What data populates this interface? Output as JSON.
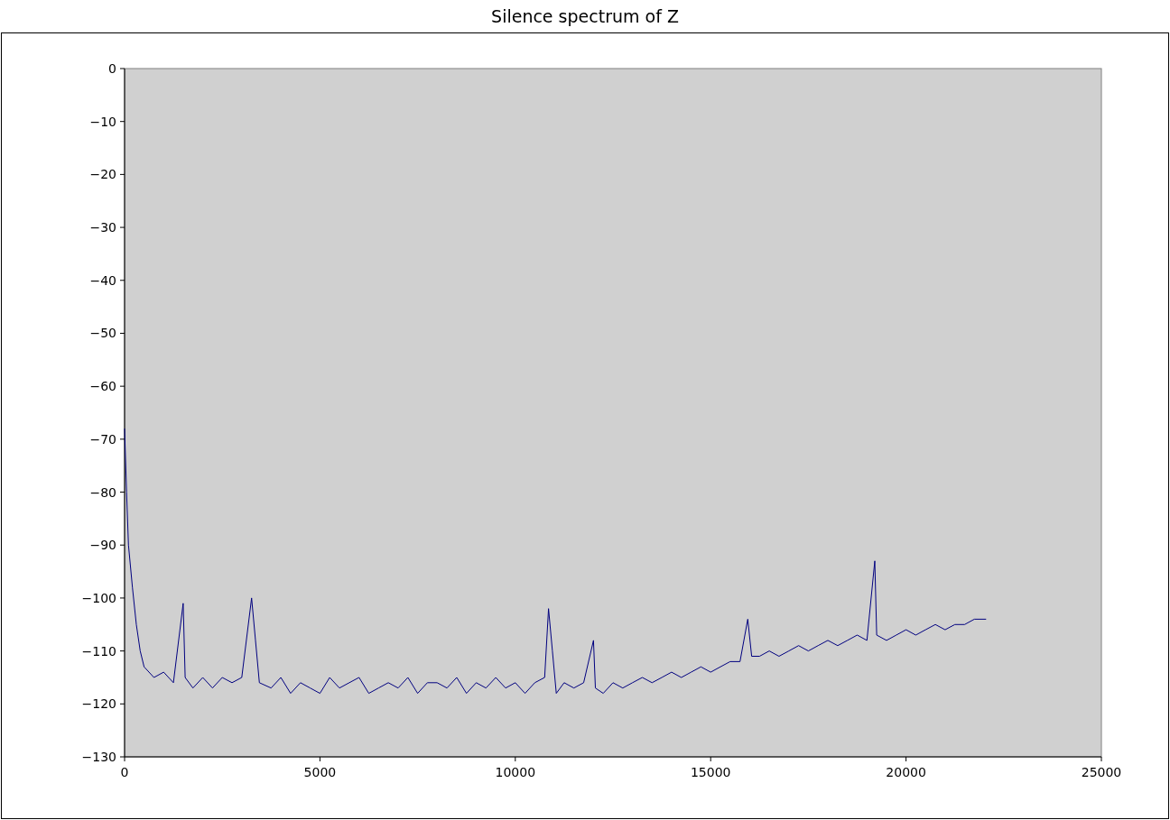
{
  "chart_data": {
    "type": "line",
    "title": "Silence spectrum of Z",
    "xlim": [
      0,
      25000
    ],
    "ylim": [
      -130,
      0
    ],
    "xticks": [
      0,
      5000,
      10000,
      15000,
      20000,
      25000
    ],
    "yticks": [
      0,
      {
        "value": -10,
        "label": "−10"
      },
      {
        "value": -20,
        "label": "−20"
      },
      {
        "value": -30,
        "label": "−30"
      },
      {
        "value": -40,
        "label": "−40"
      },
      {
        "value": -50,
        "label": "−50"
      },
      {
        "value": -60,
        "label": "−60"
      },
      {
        "value": -70,
        "label": "−70"
      },
      {
        "value": -80,
        "label": "−80"
      },
      {
        "value": -90,
        "label": "−90"
      },
      {
        "value": -100,
        "label": "−100"
      },
      {
        "value": -110,
        "label": "−110"
      },
      {
        "value": -120,
        "label": "−120"
      },
      {
        "value": -130,
        "label": "−130"
      }
    ],
    "x": [
      0,
      50,
      100,
      200,
      300,
      400,
      500,
      750,
      1000,
      1250,
      1500,
      1550,
      1750,
      2000,
      2250,
      2500,
      2750,
      3000,
      3250,
      3350,
      3450,
      3750,
      4000,
      4250,
      4500,
      4750,
      5000,
      5250,
      5500,
      5750,
      6000,
      6250,
      6500,
      6750,
      7000,
      7250,
      7500,
      7750,
      8000,
      8250,
      8500,
      8750,
      9000,
      9250,
      9500,
      9750,
      10000,
      10250,
      10500,
      10750,
      10850,
      10950,
      11050,
      11250,
      11500,
      11750,
      12000,
      12050,
      12250,
      12500,
      12750,
      13000,
      13250,
      13500,
      13750,
      14000,
      14250,
      14500,
      14750,
      15000,
      15250,
      15500,
      15750,
      15950,
      16050,
      16250,
      16500,
      16750,
      17000,
      17250,
      17500,
      17750,
      18000,
      18250,
      18500,
      18750,
      19000,
      19200,
      19250,
      19500,
      19750,
      20000,
      20250,
      20500,
      20750,
      21000,
      21250,
      21500,
      21750,
      22050
    ],
    "series": [
      {
        "color": "#00007f",
        "values": [
          -68,
          -80,
          -90,
          -98,
          -105,
          -110,
          -113,
          -115,
          -114,
          -116,
          -101,
          -115,
          -117,
          -115,
          -117,
          -115,
          -116,
          -115,
          -100,
          -108,
          -116,
          -117,
          -115,
          -118,
          -116,
          -117,
          -118,
          -115,
          -117,
          -116,
          -115,
          -118,
          -117,
          -116,
          -117,
          -115,
          -118,
          -116,
          -116,
          -117,
          -115,
          -118,
          -116,
          -117,
          -115,
          -117,
          -116,
          -118,
          -116,
          -115,
          -102,
          -110,
          -118,
          -116,
          -117,
          -116,
          -108,
          -117,
          -118,
          -116,
          -117,
          -116,
          -115,
          -116,
          -115,
          -114,
          -115,
          -114,
          -113,
          -114,
          -113,
          -112,
          -112,
          -104,
          -111,
          -111,
          -110,
          -111,
          -110,
          -109,
          -110,
          -109,
          -108,
          -109,
          -108,
          -107,
          -108,
          -93,
          -107,
          -108,
          -107,
          -106,
          -107,
          -106,
          -105,
          -106,
          -105,
          -105,
          -104,
          -104
        ]
      }
    ]
  }
}
